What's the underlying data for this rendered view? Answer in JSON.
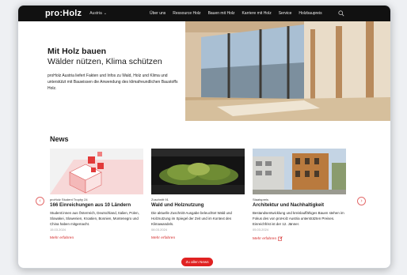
{
  "colors": {
    "accent": "#e02222",
    "nav_bg": "#111111"
  },
  "nav": {
    "logo": "pro:Holz",
    "country": "Austria",
    "menu": [
      "Über uns",
      "Ressource Holz",
      "Bauen mit Holz",
      "Karriere mit Holz",
      "Service",
      "Holzbaupreis"
    ]
  },
  "hero": {
    "title": "Mit Holz bauen",
    "subtitle": "Wälder nützen, Klima schützen",
    "body": "proHolz Austria liefert Fakten und Infos zu Wald, Holz und Klima und unterstützt mit Bauwissen die Anwendung des klimafreundlichen Baustoffs Holz."
  },
  "news": {
    "title": "News",
    "all_button": "Zu allen News",
    "cards": [
      {
        "kicker": "proHolz Student Trophy 24",
        "title": "166 Einreichungen aus 10 Ländern",
        "text": "Student:innen aus Österreich, Deutschland, Italien, Polen, Slowakei, Slowenien, Kroatien, Bosnien, Montenegro und China haben mitgemacht.",
        "date": "15.03.2024",
        "more": "Mehr erfahren"
      },
      {
        "kicker": "Zuschnitt 91",
        "title": "Wald und Holznutzung",
        "text": "Die aktuelle Zuschnitt-Ausgabe beleuchtet Wald und Holznutzung im Spiegel der Zeit und im Kontext des Klimawandels.",
        "date": "08.03.2024",
        "more": "Mehr erfahren"
      },
      {
        "kicker": "Staatspreis",
        "title": "Architektur und Nachhaltigkeit",
        "text": "Bestandsentwicklung und kreislauffähiges Bauen stehen im Fokus des von proHolz Austria unterstützten Preises. Einreichfrist ist der 12. Jänner.",
        "date": "05.03.2024",
        "more": "Mehr erfahren"
      }
    ]
  }
}
